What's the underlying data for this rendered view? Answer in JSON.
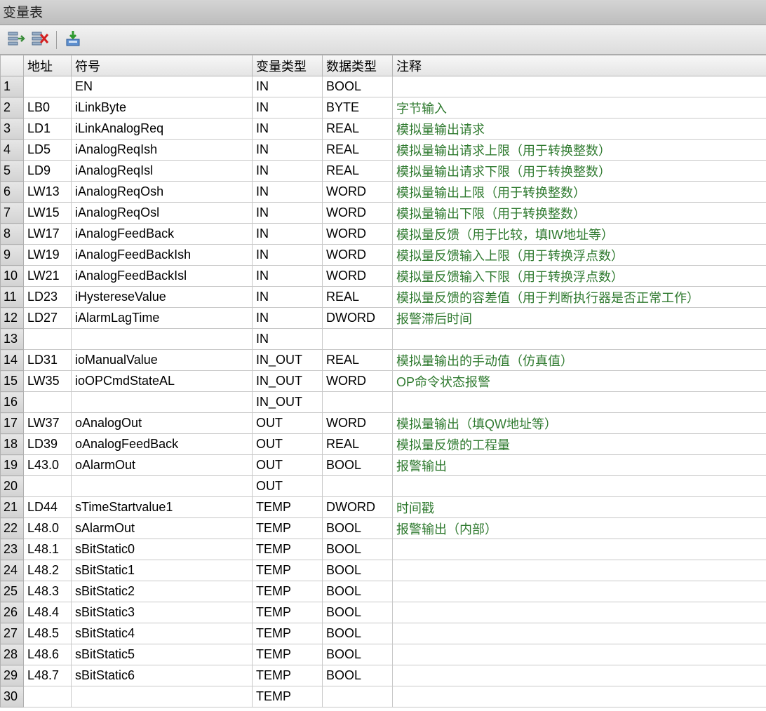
{
  "window": {
    "title": "变量表"
  },
  "toolbar": {
    "buttons": [
      {
        "icon": "insert-row-icon"
      },
      {
        "icon": "delete-row-icon"
      },
      {
        "icon": "download-block-icon"
      }
    ]
  },
  "table": {
    "headers": {
      "rownum": "",
      "address": "地址",
      "symbol": "符号",
      "var_type": "变量类型",
      "data_type": "数据类型",
      "comment": "注释"
    },
    "rows": [
      {
        "n": "1",
        "addr": "",
        "sym": "EN",
        "vt": "IN",
        "dt": "BOOL",
        "cm": ""
      },
      {
        "n": "2",
        "addr": "LB0",
        "sym": "iLinkByte",
        "vt": "IN",
        "dt": "BYTE",
        "cm": "字节输入"
      },
      {
        "n": "3",
        "addr": "LD1",
        "sym": "iLinkAnalogReq",
        "vt": "IN",
        "dt": "REAL",
        "cm": "模拟量输出请求"
      },
      {
        "n": "4",
        "addr": "LD5",
        "sym": "iAnalogReqIsh",
        "vt": "IN",
        "dt": "REAL",
        "cm": "模拟量输出请求上限（用于转换整数）"
      },
      {
        "n": "5",
        "addr": "LD9",
        "sym": "iAnalogReqIsl",
        "vt": "IN",
        "dt": "REAL",
        "cm": "模拟量输出请求下限（用于转换整数）"
      },
      {
        "n": "6",
        "addr": "LW13",
        "sym": "iAnalogReqOsh",
        "vt": "IN",
        "dt": "WORD",
        "cm": "模拟量输出上限（用于转换整数）"
      },
      {
        "n": "7",
        "addr": "LW15",
        "sym": "iAnalogReqOsl",
        "vt": "IN",
        "dt": "WORD",
        "cm": "模拟量输出下限（用于转换整数）"
      },
      {
        "n": "8",
        "addr": "LW17",
        "sym": "iAnalogFeedBack",
        "vt": "IN",
        "dt": "WORD",
        "cm": "模拟量反馈（用于比较，填IW地址等）"
      },
      {
        "n": "9",
        "addr": "LW19",
        "sym": "iAnalogFeedBackIsh",
        "vt": "IN",
        "dt": "WORD",
        "cm": "模拟量反馈输入上限（用于转换浮点数）"
      },
      {
        "n": "10",
        "addr": "LW21",
        "sym": "iAnalogFeedBackIsl",
        "vt": "IN",
        "dt": "WORD",
        "cm": "模拟量反馈输入下限（用于转换浮点数）"
      },
      {
        "n": "11",
        "addr": "LD23",
        "sym": "iHystereseValue",
        "vt": "IN",
        "dt": "REAL",
        "cm": "模拟量反馈的容差值（用于判断执行器是否正常工作）"
      },
      {
        "n": "12",
        "addr": "LD27",
        "sym": "iAlarmLagTime",
        "vt": "IN",
        "dt": "DWORD",
        "cm": "报警滞后时间"
      },
      {
        "n": "13",
        "addr": "",
        "sym": "",
        "vt": "IN",
        "dt": "",
        "cm": ""
      },
      {
        "n": "14",
        "addr": "LD31",
        "sym": "ioManualValue",
        "vt": "IN_OUT",
        "dt": "REAL",
        "cm": "模拟量输出的手动值（仿真值）"
      },
      {
        "n": "15",
        "addr": "LW35",
        "sym": "ioOPCmdStateAL",
        "vt": "IN_OUT",
        "dt": "WORD",
        "cm": "OP命令状态报警"
      },
      {
        "n": "16",
        "addr": "",
        "sym": "",
        "vt": "IN_OUT",
        "dt": "",
        "cm": ""
      },
      {
        "n": "17",
        "addr": "LW37",
        "sym": "oAnalogOut",
        "vt": "OUT",
        "dt": "WORD",
        "cm": "模拟量输出（填QW地址等）"
      },
      {
        "n": "18",
        "addr": "LD39",
        "sym": "oAnalogFeedBack",
        "vt": "OUT",
        "dt": "REAL",
        "cm": "模拟量反馈的工程量"
      },
      {
        "n": "19",
        "addr": "L43.0",
        "sym": "oAlarmOut",
        "vt": "OUT",
        "dt": "BOOL",
        "cm": "报警输出"
      },
      {
        "n": "20",
        "addr": "",
        "sym": "",
        "vt": "OUT",
        "dt": "",
        "cm": ""
      },
      {
        "n": "21",
        "addr": "LD44",
        "sym": "sTimeStartvalue1",
        "vt": "TEMP",
        "dt": "DWORD",
        "cm": "时间戳"
      },
      {
        "n": "22",
        "addr": "L48.0",
        "sym": "sAlarmOut",
        "vt": "TEMP",
        "dt": "BOOL",
        "cm": "报警输出（内部）"
      },
      {
        "n": "23",
        "addr": "L48.1",
        "sym": "sBitStatic0",
        "vt": "TEMP",
        "dt": "BOOL",
        "cm": ""
      },
      {
        "n": "24",
        "addr": "L48.2",
        "sym": "sBitStatic1",
        "vt": "TEMP",
        "dt": "BOOL",
        "cm": ""
      },
      {
        "n": "25",
        "addr": "L48.3",
        "sym": "sBitStatic2",
        "vt": "TEMP",
        "dt": "BOOL",
        "cm": ""
      },
      {
        "n": "26",
        "addr": "L48.4",
        "sym": "sBitStatic3",
        "vt": "TEMP",
        "dt": "BOOL",
        "cm": ""
      },
      {
        "n": "27",
        "addr": "L48.5",
        "sym": "sBitStatic4",
        "vt": "TEMP",
        "dt": "BOOL",
        "cm": ""
      },
      {
        "n": "28",
        "addr": "L48.6",
        "sym": "sBitStatic5",
        "vt": "TEMP",
        "dt": "BOOL",
        "cm": ""
      },
      {
        "n": "29",
        "addr": "L48.7",
        "sym": "sBitStatic6",
        "vt": "TEMP",
        "dt": "BOOL",
        "cm": ""
      },
      {
        "n": "30",
        "addr": "",
        "sym": "",
        "vt": "TEMP",
        "dt": "",
        "cm": ""
      }
    ]
  },
  "colors": {
    "comment_text": "#2f7a2f",
    "row_header_bg": "#d9d9d9",
    "title_bar_bg": "#c8c8c8"
  }
}
